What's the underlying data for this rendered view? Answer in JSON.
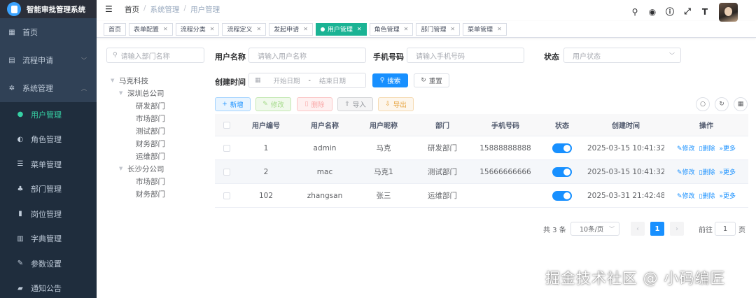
{
  "app": {
    "title": "智能审批管理系统"
  },
  "sidebar": {
    "items": [
      {
        "label": "首页",
        "icon": "dashboard-icon"
      },
      {
        "label": "流程申请",
        "icon": "document-icon"
      },
      {
        "label": "系统管理",
        "icon": "gear-icon"
      }
    ],
    "submenu": [
      {
        "label": "用户管理",
        "icon": "user-icon",
        "active": true
      },
      {
        "label": "角色管理",
        "icon": "users-icon"
      },
      {
        "label": "菜单管理",
        "icon": "list-icon"
      },
      {
        "label": "部门管理",
        "icon": "org-tree-icon"
      },
      {
        "label": "岗位管理",
        "icon": "post-icon"
      },
      {
        "label": "字典管理",
        "icon": "dictionary-icon"
      },
      {
        "label": "参数设置",
        "icon": "edit-icon"
      },
      {
        "label": "通知公告",
        "icon": "message-icon"
      }
    ]
  },
  "breadcrumb": [
    "首页",
    "系统管理",
    "用户管理"
  ],
  "tags": [
    {
      "label": "首页",
      "closable": false
    },
    {
      "label": "表单配置",
      "closable": true
    },
    {
      "label": "流程分类",
      "closable": true
    },
    {
      "label": "流程定义",
      "closable": true
    },
    {
      "label": "发起申请",
      "closable": true
    },
    {
      "label": "用户管理",
      "closable": true,
      "active": true
    },
    {
      "label": "角色管理",
      "closable": true
    },
    {
      "label": "部门管理",
      "closable": true
    },
    {
      "label": "菜单管理",
      "closable": true
    }
  ],
  "tree": {
    "search_placeholder": "请输入部门名称",
    "nodes": [
      {
        "label": "马克科技",
        "level": 0,
        "expandable": true
      },
      {
        "label": "深圳总公司",
        "level": 1,
        "expandable": true
      },
      {
        "label": "研发部门",
        "level": 2
      },
      {
        "label": "市场部门",
        "level": 2
      },
      {
        "label": "测试部门",
        "level": 2
      },
      {
        "label": "财务部门",
        "level": 2
      },
      {
        "label": "运维部门",
        "level": 2
      },
      {
        "label": "长沙分公司",
        "level": 1,
        "expandable": true
      },
      {
        "label": "市场部门",
        "level": 2
      },
      {
        "label": "财务部门",
        "level": 2
      }
    ]
  },
  "search": {
    "username_label": "用户名称",
    "username_placeholder": "请输入用户名称",
    "phone_label": "手机号码",
    "phone_placeholder": "请输入手机号码",
    "status_label": "状态",
    "status_placeholder": "用户状态",
    "created_label": "创建时间",
    "start_placeholder": "开始日期",
    "range_sep": "-",
    "end_placeholder": "结束日期",
    "search_button": "搜索",
    "reset_button": "重置"
  },
  "actions": {
    "add": "新增",
    "edit": "修改",
    "delete": "删除",
    "import": "导入",
    "export": "导出"
  },
  "table": {
    "headers": [
      "用户编号",
      "用户名称",
      "用户昵称",
      "部门",
      "手机号码",
      "状态",
      "创建时间",
      "操作"
    ],
    "rows": [
      {
        "id": "1",
        "username": "admin",
        "nickname": "马克",
        "dept": "研发部门",
        "phone": "15888888888",
        "enabled": true,
        "created": "2025-03-15 10:41:32"
      },
      {
        "id": "2",
        "username": "mac",
        "nickname": "马克1",
        "dept": "测试部门",
        "phone": "15666666666",
        "enabled": true,
        "created": "2025-03-15 10:41:32"
      },
      {
        "id": "102",
        "username": "zhangsan",
        "nickname": "张三",
        "dept": "运维部门",
        "phone": "",
        "enabled": true,
        "created": "2025-03-31 21:42:48"
      }
    ],
    "op_edit": "修改",
    "op_delete": "删除",
    "op_more": "更多"
  },
  "pagination": {
    "total_text": "共 3 条",
    "page_size": "10条/页",
    "current_page": "1",
    "goto_prefix": "前往",
    "goto_value": "1",
    "goto_suffix": "页"
  },
  "watermark": "掘金技术社区 @ 小码编匠"
}
